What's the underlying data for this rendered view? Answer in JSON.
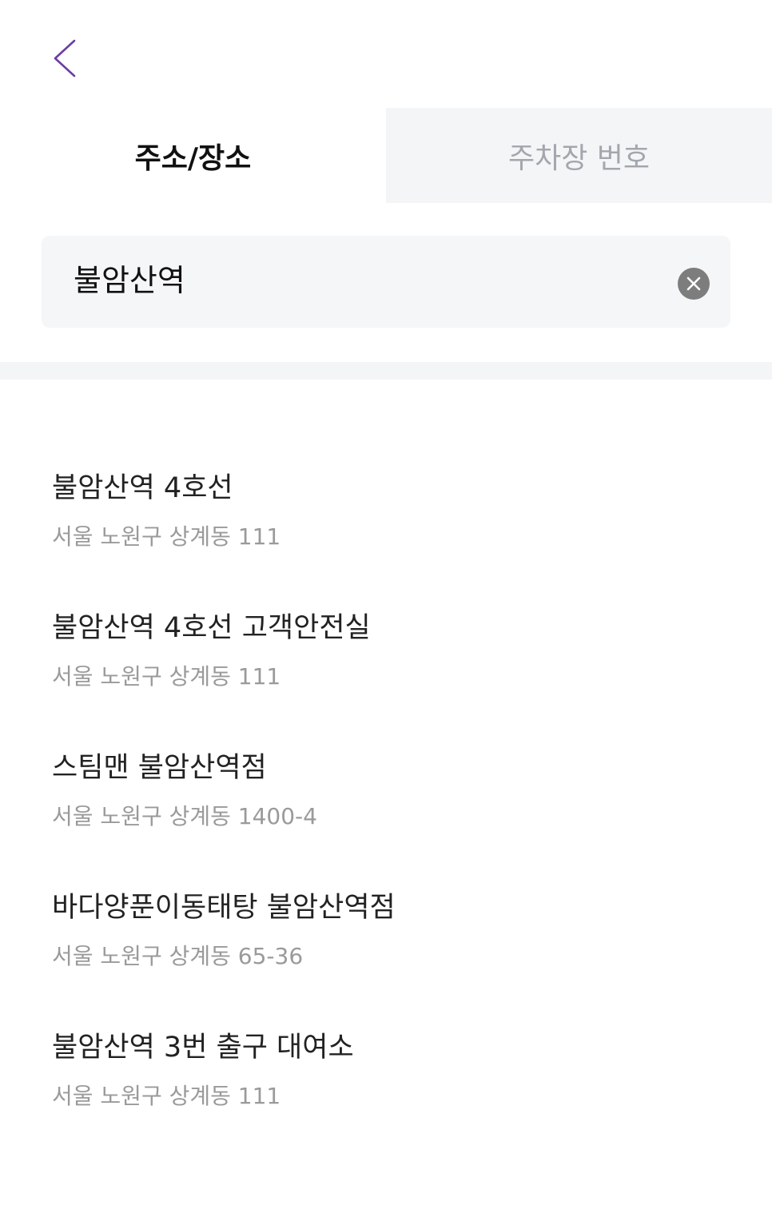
{
  "tabs": [
    {
      "label": "주소/장소",
      "active": true
    },
    {
      "label": "주차장 번호",
      "active": false
    }
  ],
  "search": {
    "value": "불암산역"
  },
  "results": [
    {
      "name": "불암산역 4호선",
      "address": "서울 노원구 상계동 111"
    },
    {
      "name": "불암산역 4호선 고객안전실",
      "address": "서울 노원구 상계동 111"
    },
    {
      "name": "스팀맨 불암산역점",
      "address": "서울 노원구 상계동 1400-4"
    },
    {
      "name": "바다양푼이동태탕 불암산역점",
      "address": "서울 노원구 상계동 65-36"
    },
    {
      "name": "불암산역 3번 출구 대여소",
      "address": "서울 노원구 상계동 111"
    }
  ],
  "icons": {
    "back": "chevron-left-icon",
    "clear": "clear-x-circle-icon"
  },
  "colors": {
    "accent": "#6a3fa0",
    "tab_inactive_bg": "#f4f5f7",
    "tab_inactive_text": "#a3a7ad",
    "address_text": "#9a9a9a"
  }
}
